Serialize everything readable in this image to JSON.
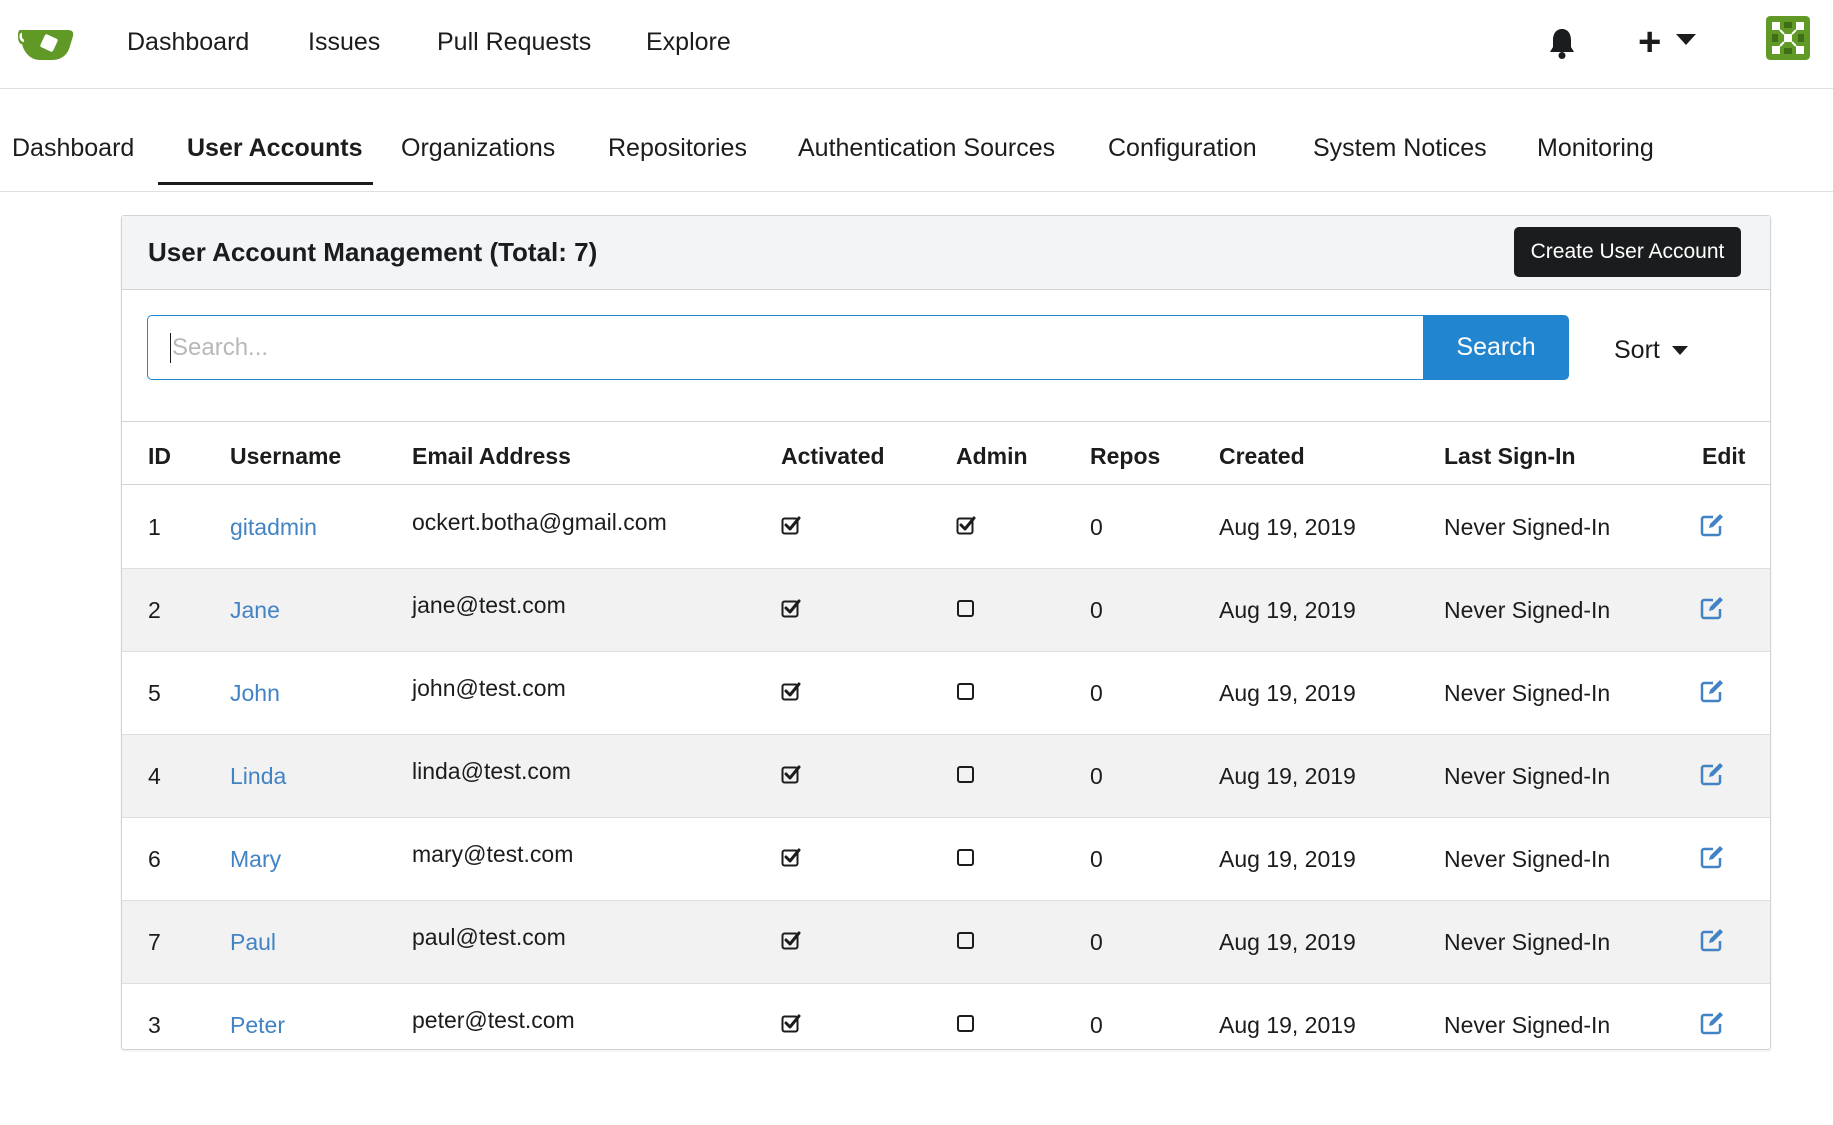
{
  "topnav": {
    "items": [
      "Dashboard",
      "Issues",
      "Pull Requests",
      "Explore"
    ],
    "plus_label": "+"
  },
  "subnav": {
    "items": [
      "Dashboard",
      "User Accounts",
      "Organizations",
      "Repositories",
      "Authentication Sources",
      "Configuration",
      "System Notices",
      "Monitoring"
    ],
    "active_index": 1
  },
  "panel": {
    "title": "User Account Management (Total: 7)",
    "create_button": "Create User Account"
  },
  "search": {
    "placeholder": "Search...",
    "value": "",
    "button": "Search",
    "sort_label": "Sort"
  },
  "table": {
    "columns": [
      "ID",
      "Username",
      "Email Address",
      "Activated",
      "Admin",
      "Repos",
      "Created",
      "Last Sign-In",
      "Edit"
    ],
    "rows": [
      {
        "id": "1",
        "username": "gitadmin",
        "email": "ockert.botha@gmail.com",
        "activated": true,
        "admin": true,
        "repos": "0",
        "created": "Aug 19, 2019",
        "last_signin": "Never Signed-In"
      },
      {
        "id": "2",
        "username": "Jane",
        "email": "jane@test.com",
        "activated": true,
        "admin": false,
        "repos": "0",
        "created": "Aug 19, 2019",
        "last_signin": "Never Signed-In"
      },
      {
        "id": "5",
        "username": "John",
        "email": "john@test.com",
        "activated": true,
        "admin": false,
        "repos": "0",
        "created": "Aug 19, 2019",
        "last_signin": "Never Signed-In"
      },
      {
        "id": "4",
        "username": "Linda",
        "email": "linda@test.com",
        "activated": true,
        "admin": false,
        "repos": "0",
        "created": "Aug 19, 2019",
        "last_signin": "Never Signed-In"
      },
      {
        "id": "6",
        "username": "Mary",
        "email": "mary@test.com",
        "activated": true,
        "admin": false,
        "repos": "0",
        "created": "Aug 19, 2019",
        "last_signin": "Never Signed-In"
      },
      {
        "id": "7",
        "username": "Paul",
        "email": "paul@test.com",
        "activated": true,
        "admin": false,
        "repos": "0",
        "created": "Aug 19, 2019",
        "last_signin": "Never Signed-In"
      },
      {
        "id": "3",
        "username": "Peter",
        "email": "peter@test.com",
        "activated": true,
        "admin": false,
        "repos": "0",
        "created": "Aug 19, 2019",
        "last_signin": "Never Signed-In"
      }
    ]
  },
  "icons": {
    "logo": "gitea-teacup-logo-icon",
    "notifications": "bell-icon",
    "create_menu": "plus-icon",
    "dropdown": "caret-down-icon",
    "avatar": "identicon-avatar",
    "checked": "checked-checkbox-icon",
    "unchecked": "empty-checkbox-icon",
    "edit": "edit-icon"
  },
  "colors": {
    "brand_green": "#609926",
    "primary_blue": "#2185d0",
    "link_blue": "#4183c4",
    "dark_button": "#1b1c1d",
    "header_bg": "#f3f4f5",
    "alt_row_bg": "#f2f2f2"
  }
}
